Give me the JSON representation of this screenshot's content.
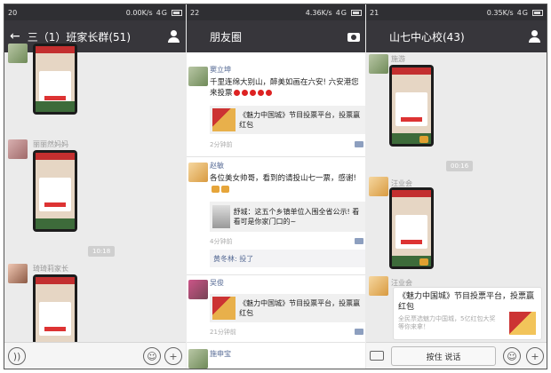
{
  "panels": [
    {
      "status": {
        "time": "20",
        "speed": "0.00K/s",
        "network": "4G"
      },
      "title": "三（1）班家长群(51)",
      "nicknames": [
        "丽丽然妈妈",
        "琦琦莉家长"
      ],
      "time_tag": "10:18"
    },
    {
      "status": {
        "time": "22",
        "speed": "4.36K/s",
        "network": "4G"
      },
      "title": "朋友圈",
      "posts": [
        {
          "name": "窦立坤",
          "text": "千里连绵大别山，醉美如画在六安! 六安港您来投票",
          "link": "《魅力中国城》节目投票平台，投票赢红包",
          "time": "2分钟前"
        },
        {
          "name": "赵敏",
          "text": "各位美女帅哥，看到的请投山七一票，感谢!",
          "link": "舒城：这五个乡镇单位入围全省公示! 看看可是你家门口的~",
          "time": "4分钟前",
          "comment": "黄冬林: 投了"
        },
        {
          "name": "吴俊",
          "text": "",
          "link": "《魅力中国城》节目投票平台，投票赢红包",
          "time": "21分钟前"
        },
        {
          "name": "施申宝"
        }
      ]
    },
    {
      "status": {
        "time": "21",
        "speed": "0.35K/s",
        "network": "4G"
      },
      "title": "山七中心校(43)",
      "nicknames": [
        "施游",
        "汪业会",
        "汪业会"
      ],
      "time_tag": "00:16",
      "card": {
        "title": "《魅力中国城》节目投票平台，投票赢红包",
        "desc": "全民票选魅力中国城，5亿红包大奖等你来拿！"
      },
      "talk_label": "按住 说话"
    }
  ]
}
